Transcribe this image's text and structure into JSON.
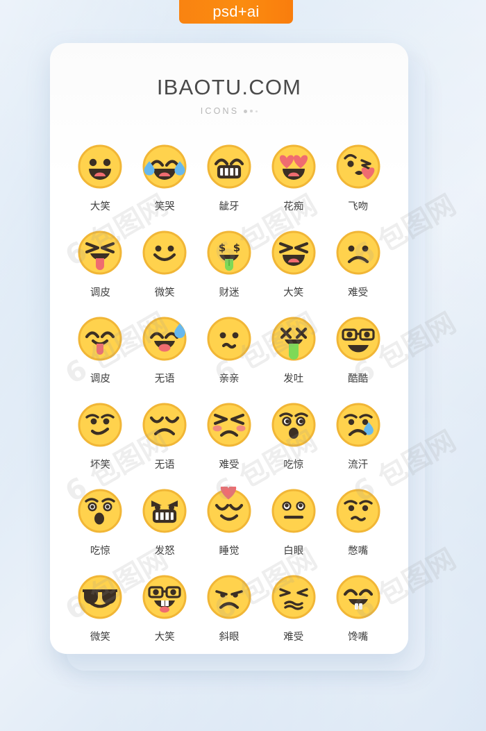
{
  "badge": {
    "label": "psd+ai",
    "color": "#f98311"
  },
  "card": {
    "title": "IBAOTU.COM",
    "subtitle": "ICONS",
    "bg": "#ffffff"
  },
  "palette": {
    "face": "#ffd24d",
    "face_dark": "#f1b636",
    "stroke": "#3b2f24",
    "tongue": "#ef6c70",
    "tongue_green": "#7ed957",
    "tear": "#66b8ee",
    "heart": "#ef6c70",
    "blush": "#ef7f86",
    "label": "#3d3d3d"
  },
  "watermark": {
    "text": "包图网",
    "mark": "6"
  },
  "icons": [
    {
      "label": "大笑",
      "name": "grinning-open-mouth"
    },
    {
      "label": "笑哭",
      "name": "laughing-tears"
    },
    {
      "label": "龇牙",
      "name": "grinning-teeth"
    },
    {
      "label": "花痴",
      "name": "heart-eyes"
    },
    {
      "label": "飞吻",
      "name": "blowing-kiss"
    },
    {
      "label": "调皮",
      "name": "squint-tongue-out"
    },
    {
      "label": "微笑",
      "name": "simple-smile"
    },
    {
      "label": "财迷",
      "name": "money-face"
    },
    {
      "label": "大笑",
      "name": "laughing-squint-open"
    },
    {
      "label": "难受",
      "name": "frowning-face"
    },
    {
      "label": "调皮",
      "name": "happy-tongue-out"
    },
    {
      "label": "无语",
      "name": "sweat-laugh"
    },
    {
      "label": "亲亲",
      "name": "kissing-face"
    },
    {
      "label": "发吐",
      "name": "vomiting-face"
    },
    {
      "label": "酷酷",
      "name": "nerd-glasses-grin"
    },
    {
      "label": "坏笑",
      "name": "smirking-face"
    },
    {
      "label": "无语",
      "name": "disappointed-closed-eyes"
    },
    {
      "label": "难受",
      "name": "persevering-blush"
    },
    {
      "label": "吃惊",
      "name": "astonished-face"
    },
    {
      "label": "流汗",
      "name": "crying-single-tear"
    },
    {
      "label": "吃惊",
      "name": "shocked-face"
    },
    {
      "label": "发怒",
      "name": "angry-teeth"
    },
    {
      "label": "睡觉",
      "name": "sleeping-heart"
    },
    {
      "label": "白眼",
      "name": "neutral-face"
    },
    {
      "label": "憋嘴",
      "name": "wavy-mouth-face"
    },
    {
      "label": "微笑",
      "name": "sunglasses-smile"
    },
    {
      "label": "大笑",
      "name": "nerd-buck-teeth"
    },
    {
      "label": "斜眼",
      "name": "side-eye-frown"
    },
    {
      "label": "难受",
      "name": "scrunched-face"
    },
    {
      "label": "馋嘴",
      "name": "drooling-teeth"
    }
  ]
}
